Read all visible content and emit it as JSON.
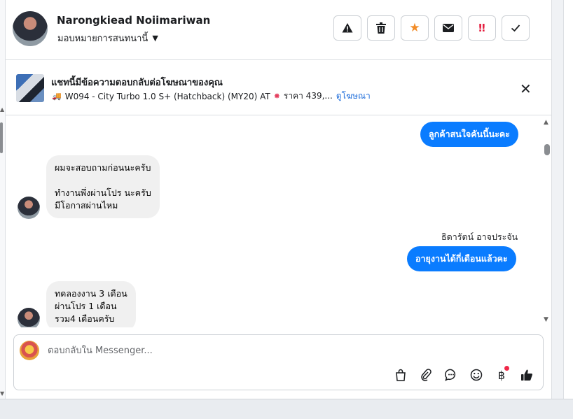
{
  "header": {
    "user_name": "Narongkiead Noiimariwan",
    "assign_label": "มอบหมายการสนทนานี้"
  },
  "ad": {
    "title": "แชทนี้มีข้อความตอบกลับต่อโฆษณาของคุณ",
    "description": "W094 - City Turbo 1.0 S+ (Hatchback) (MY20) AT",
    "price": "ราคา 439,...",
    "link_label": "ดูโฆษณา"
  },
  "messages": {
    "out_1": "ลูกค้าสนใจคันนี้นะคะ",
    "in_1": "ผมจะสอบถามก่อนนะครับ\n\nทำงานพึ่งผ่านโปร นะครับ\nมีโอกาสผ่านไหม",
    "sender_name": "ธิดารัตน์ อาจประจัน",
    "out_2": "อายุงานได้กี่เดือนแล้วคะ",
    "in_2": "ทดลองงาน 3 เดือน\nผ่านโปร 1 เดือน\nรวม4 เดือนครับ"
  },
  "composer": {
    "placeholder": "ตอบกลับใน Messenger..."
  },
  "icons": {
    "warning": "warning-icon",
    "trash": "trash-icon",
    "star": "star-icon",
    "mail": "mail-icon",
    "urgent": "urgent-icon",
    "check": "check-icon"
  },
  "colors": {
    "accent": "#0a7cff",
    "star": "#f28c28",
    "urgent": "#e41e3f"
  }
}
